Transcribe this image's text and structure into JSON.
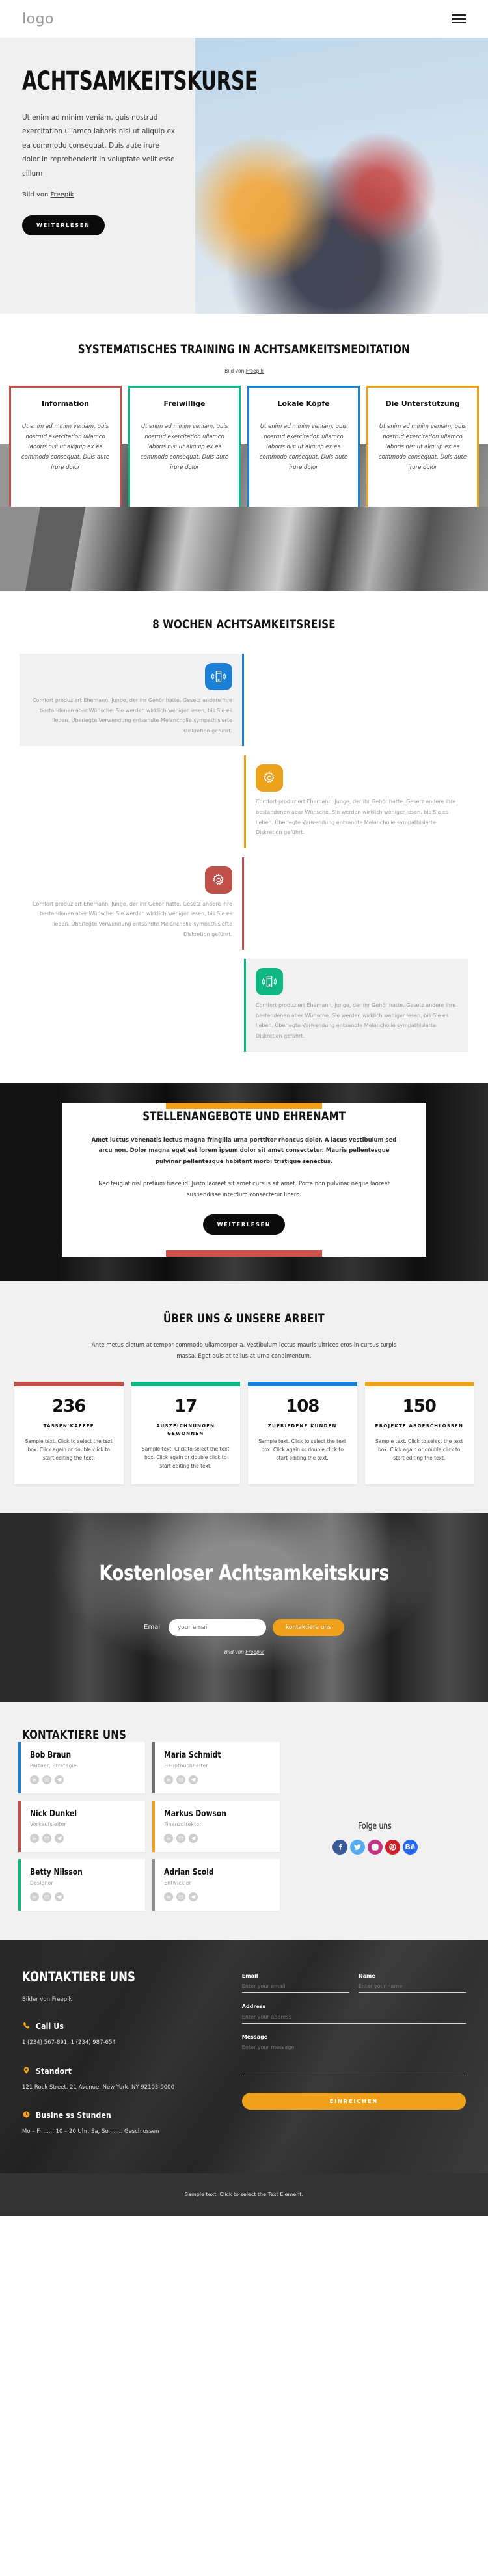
{
  "header": {
    "logo": "logo",
    "menu_icon": "hamburger-menu-icon"
  },
  "hero": {
    "title": "Achtsamkeitskurse",
    "body": "Ut enim ad minim veniam, quis nostrud exercitation ullamco laboris nisi ut aliquip ex ea commodo consequat. Duis aute irure dolor in reprehenderit in voluptate velit esse cillum",
    "credit_prefix": "Bild von ",
    "credit_link": "Freepik",
    "button": "Weiterlesen"
  },
  "training": {
    "heading": "Systematisches Training in Achtsamkeitsmeditation",
    "credit_prefix": "Bild von ",
    "credit_link": "Freepik",
    "cards": [
      {
        "title": "Information",
        "text": "Ut enim ad minim veniam, quis nostrud exercitation ullamco laboris nisi ut aliquip ex ea commodo consequat. Duis aute irure dolor",
        "color": "#c0504a"
      },
      {
        "title": "Freiwillige",
        "text": "Ut enim ad minim veniam, quis nostrud exercitation ullamco laboris nisi ut aliquip ex ea commodo consequat. Duis aute irure dolor",
        "color": "#0fb882"
      },
      {
        "title": "Lokale Köpfe",
        "text": "Ut enim ad minim veniam, quis nostrud exercitation ullamco laboris nisi ut aliquip ex ea commodo consequat. Duis aute irure dolor",
        "color": "#1b7fd4"
      },
      {
        "title": "Die Unterstützung",
        "text": "Ut enim ad minim veniam, quis nostrud exercitation ullamco laboris nisi ut aliquip ex ea commodo consequat. Duis aute irure dolor",
        "color": "#eda21b"
      }
    ]
  },
  "journey": {
    "heading": "8 Wochen Achtsamkeitsreise",
    "body": "Comfort produziert Ehemann, Junge, der ihr Gehör hatte. Gesetz andere ihre bestandenen aber Wünsche. Sie werden wirklich weniger lesen, bis Sie es lieben. Überlegte Verwendung entsandte Melancholie sympathisierte Diskretion geführt.",
    "steps": [
      {
        "side": "left",
        "color": "#1b7fd4",
        "icon": "mobile-vibrate-icon",
        "shaded": true
      },
      {
        "side": "right",
        "color": "#eda21b",
        "icon": "gear-icon",
        "shaded": false
      },
      {
        "side": "left",
        "color": "#c0504a",
        "icon": "gear-icon",
        "shaded": false
      },
      {
        "side": "right",
        "color": "#0fb882",
        "icon": "mobile-vibrate-icon",
        "shaded": true
      }
    ]
  },
  "jobs": {
    "heading": "Stellenangebote und Ehrenamt",
    "paragraph1": "Amet luctus venenatis lectus magna fringilla urna porttitor rhoncus dolor. A lacus vestibulum sed arcu non. Dolor magna eget est lorem ipsum dolor sit amet consectetur. Mauris pellentesque pulvinar pellentesque habitant morbi tristique senectus.",
    "paragraph2": "Nec feugiat nisl pretium fusce id. Justo laoreet sit amet cursus sit amet. Porta non pulvinar neque laoreet suspendisse interdum consectetur libero.",
    "button": "Weiterlesen",
    "accent_top": "#eda21b",
    "accent_bottom": "#cf5149"
  },
  "about": {
    "heading": "Über uns & unsere Arbeit",
    "lede": "Ante metus dictum at tempor commodo ullamcorper a. Vestibulum lectus mauris ultrices eros in cursus turpis massa. Eget duis at tellus at urna condimentum.",
    "stats": [
      {
        "number": "236",
        "label": "Tassen Kaffee",
        "text": "Sample text. Click to select the text box. Click again or double click to start editing the text.",
        "color": "#c0504a"
      },
      {
        "number": "17",
        "label": "Auszeichnungen gewonnen",
        "text": "Sample text. Click to select the text box. Click again or double click to start editing the text.",
        "color": "#0fb882"
      },
      {
        "number": "108",
        "label": "Zufriedene Kunden",
        "text": "Sample text. Click to select the text box. Click again or double click to start editing the text.",
        "color": "#1b7fd4"
      },
      {
        "number": "150",
        "label": "Projekte abgeschlossen",
        "text": "Sample text. Click to select the text box. Click again or double click to start editing the text.",
        "color": "#eda21b"
      }
    ]
  },
  "cta": {
    "heading": "Kostenloser Achtsamkeitskurs",
    "email_label": "Email",
    "email_placeholder": "your email",
    "button": "kontaktiere uns",
    "credit_prefix": "Bild von ",
    "credit_link": "Freepik"
  },
  "team": {
    "heading": "Kontaktiere uns",
    "members": [
      {
        "name": "Bob Braun",
        "role": "Partner, Strategie",
        "color": "#1b7fd4"
      },
      {
        "name": "Maria Schmidt",
        "role": "Hauptbuchhalter",
        "color": "#707070"
      },
      {
        "name": "Nick Dunkel",
        "role": "Verkaufsleiter",
        "color": "#c0504a"
      },
      {
        "name": "Markus Dowson",
        "role": "Finanzdirektor",
        "color": "#eda21b"
      },
      {
        "name": "Betty Nilsson",
        "role": "Designer",
        "color": "#0fb882"
      },
      {
        "name": "Adrian Scold",
        "role": "Entwickler",
        "color": "#8f8f8f"
      }
    ],
    "member_icons": [
      "linkedin-icon",
      "email-icon",
      "telegram-icon"
    ],
    "follow_title": "Folge uns",
    "follow": [
      {
        "name": "facebook-icon",
        "glyph": "f",
        "color": "#3b5998"
      },
      {
        "name": "twitter-icon",
        "glyph": "t",
        "color": "#56acee"
      },
      {
        "name": "instagram-icon",
        "glyph": "o",
        "color": "#c13584"
      },
      {
        "name": "pinterest-icon",
        "glyph": "P",
        "color": "#cb2027"
      },
      {
        "name": "behance-icon",
        "glyph": "Bē",
        "color": "#2468f6"
      }
    ]
  },
  "footer": {
    "heading": "Kontaktiere uns",
    "credit_prefix": "Bilder von ",
    "credit_link": "Freepik",
    "blocks": [
      {
        "icon": "phone-icon",
        "title": "Call Us",
        "value": "1 (234) 567-891, 1 (234) 987-654"
      },
      {
        "icon": "pin-icon",
        "title": "Standort",
        "value": "121 Rock Street, 21 Avenue, New York, NY 92103-9000"
      },
      {
        "icon": "clock-icon",
        "title": "Busine ss Stunden",
        "value": "Mo – Fr ...... 10 – 20 Uhr, Sa, So ....... Geschlossen"
      }
    ],
    "form": {
      "email_label": "Email",
      "email_placeholder": "Enter your email",
      "name_label": "Name",
      "name_placeholder": "Enter your name",
      "address_label": "Address",
      "address_placeholder": "Enter your address",
      "message_label": "Message",
      "message_placeholder": "Enter your message",
      "submit": "Einreichen"
    },
    "bottom_text": "Sample text. Click to select the Text Element."
  }
}
